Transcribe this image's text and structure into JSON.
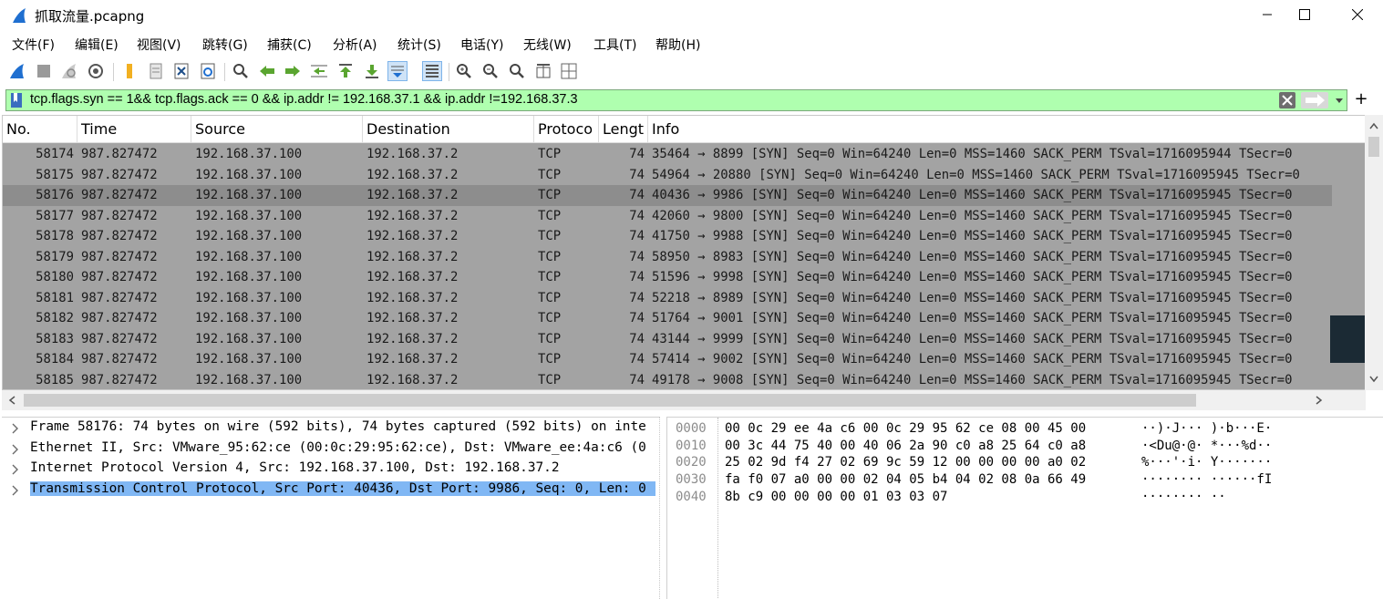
{
  "window": {
    "title": "抓取流量.pcapng"
  },
  "menu": [
    "文件(F)",
    "编辑(E)",
    "视图(V)",
    "跳转(G)",
    "捕获(C)",
    "分析(A)",
    "统计(S)",
    "电话(Y)",
    "无线(W)",
    "工具(T)",
    "帮助(H)"
  ],
  "toolbar": [
    "start-capture-icon",
    "stop-capture-icon",
    "restart-capture-icon",
    "capture-options-icon",
    "open-file-icon",
    "save-file-icon",
    "close-file-icon",
    "reload-file-icon",
    "find-packet-icon",
    "go-back-icon",
    "go-forward-icon",
    "go-to-packet-icon",
    "go-first-icon",
    "go-last-icon",
    "autoscroll-icon",
    "colorize-icon",
    "zoom-in-icon",
    "zoom-out-icon",
    "zoom-normal-icon",
    "resize-columns-icon",
    "layout-icon"
  ],
  "filter": {
    "text": "tcp.flags.syn == 1&& tcp.flags.ack == 0 && ip.addr != 192.168.37.1 && ip.addr !=192.168.37.3",
    "add_label": "+"
  },
  "columns": [
    "No.",
    "Time",
    "Source",
    "Destination",
    "Protoco",
    "Lengt",
    "Info"
  ],
  "packets": [
    {
      "no": "58174",
      "time": "987.827472",
      "src": "192.168.37.100",
      "dst": "192.168.37.2",
      "proto": "TCP",
      "len": "74",
      "info": "35464 → 8899 [SYN] Seq=0 Win=64240 Len=0 MSS=1460 SACK_PERM TSval=1716095944 TSecr=0"
    },
    {
      "no": "58175",
      "time": "987.827472",
      "src": "192.168.37.100",
      "dst": "192.168.37.2",
      "proto": "TCP",
      "len": "74",
      "info": "54964 → 20880 [SYN] Seq=0 Win=64240 Len=0 MSS=1460 SACK_PERM TSval=1716095945 TSecr=0"
    },
    {
      "no": "58176",
      "time": "987.827472",
      "src": "192.168.37.100",
      "dst": "192.168.37.2",
      "proto": "TCP",
      "len": "74",
      "info": "40436 → 9986 [SYN] Seq=0 Win=64240 Len=0 MSS=1460 SACK_PERM TSval=1716095945 TSecr=0"
    },
    {
      "no": "58177",
      "time": "987.827472",
      "src": "192.168.37.100",
      "dst": "192.168.37.2",
      "proto": "TCP",
      "len": "74",
      "info": "42060 → 9800 [SYN] Seq=0 Win=64240 Len=0 MSS=1460 SACK_PERM TSval=1716095945 TSecr=0"
    },
    {
      "no": "58178",
      "time": "987.827472",
      "src": "192.168.37.100",
      "dst": "192.168.37.2",
      "proto": "TCP",
      "len": "74",
      "info": "41750 → 9988 [SYN] Seq=0 Win=64240 Len=0 MSS=1460 SACK_PERM TSval=1716095945 TSecr=0"
    },
    {
      "no": "58179",
      "time": "987.827472",
      "src": "192.168.37.100",
      "dst": "192.168.37.2",
      "proto": "TCP",
      "len": "74",
      "info": "58950 → 8983 [SYN] Seq=0 Win=64240 Len=0 MSS=1460 SACK_PERM TSval=1716095945 TSecr=0"
    },
    {
      "no": "58180",
      "time": "987.827472",
      "src": "192.168.37.100",
      "dst": "192.168.37.2",
      "proto": "TCP",
      "len": "74",
      "info": "51596 → 9998 [SYN] Seq=0 Win=64240 Len=0 MSS=1460 SACK_PERM TSval=1716095945 TSecr=0"
    },
    {
      "no": "58181",
      "time": "987.827472",
      "src": "192.168.37.100",
      "dst": "192.168.37.2",
      "proto": "TCP",
      "len": "74",
      "info": "52218 → 8989 [SYN] Seq=0 Win=64240 Len=0 MSS=1460 SACK_PERM TSval=1716095945 TSecr=0"
    },
    {
      "no": "58182",
      "time": "987.827472",
      "src": "192.168.37.100",
      "dst": "192.168.37.2",
      "proto": "TCP",
      "len": "74",
      "info": "51764 → 9001 [SYN] Seq=0 Win=64240 Len=0 MSS=1460 SACK_PERM TSval=1716095945 TSecr=0"
    },
    {
      "no": "58183",
      "time": "987.827472",
      "src": "192.168.37.100",
      "dst": "192.168.37.2",
      "proto": "TCP",
      "len": "74",
      "info": "43144 → 9999 [SYN] Seq=0 Win=64240 Len=0 MSS=1460 SACK_PERM TSval=1716095945 TSecr=0"
    },
    {
      "no": "58184",
      "time": "987.827472",
      "src": "192.168.37.100",
      "dst": "192.168.37.2",
      "proto": "TCP",
      "len": "74",
      "info": "57414 → 9002 [SYN] Seq=0 Win=64240 Len=0 MSS=1460 SACK_PERM TSval=1716095945 TSecr=0"
    },
    {
      "no": "58185",
      "time": "987.827472",
      "src": "192.168.37.100",
      "dst": "192.168.37.2",
      "proto": "TCP",
      "len": "74",
      "info": "49178 → 9008 [SYN] Seq=0 Win=64240 Len=0 MSS=1460 SACK_PERM TSval=1716095945 TSecr=0"
    }
  ],
  "selected_packet": "58176",
  "details": [
    {
      "text": "Frame 58176: 74 bytes on wire (592 bits), 74 bytes captured (592 bits) on inte",
      "selected": false
    },
    {
      "text": "Ethernet II, Src: VMware_95:62:ce (00:0c:29:95:62:ce), Dst: VMware_ee:4a:c6 (0",
      "selected": false
    },
    {
      "text": "Internet Protocol Version 4, Src: 192.168.37.100, Dst: 192.168.37.2",
      "selected": false
    },
    {
      "text": "Transmission Control Protocol, Src Port: 40436, Dst Port: 9986, Seq: 0, Len: 0",
      "selected": true
    }
  ],
  "bytes": [
    {
      "offset": "0000",
      "hex": "00 0c 29 ee 4a c6 00 0c  29 95 62 ce 08 00 45 00",
      "ascii": "··)·J··· )·b···E·"
    },
    {
      "offset": "0010",
      "hex": "00 3c 44 75 40 00 40 06  2a 90 c0 a8 25 64 c0 a8",
      "ascii": "·<Du@·@· *···%d··"
    },
    {
      "offset": "0020",
      "hex": "25 02 9d f4 27 02 69 9c  59 12 00 00 00 00 a0 02",
      "ascii": "%···'·i· Y·······"
    },
    {
      "offset": "0030",
      "hex": "fa f0 07 a0 00 00 02 04  05 b4 04 02 08 0a 66 49",
      "ascii": "········ ······fI"
    },
    {
      "offset": "0040",
      "hex": "8b c9 00 00 00 00 01 03  03 07",
      "ascii": "········ ··"
    }
  ],
  "colors": {
    "filter_ok": "#afffaf",
    "row_bg": "#a3a3a3",
    "row_selected": "#8d8d8d",
    "detail_selected": "#80b7f4",
    "shark_blue": "#1f6fd0"
  }
}
